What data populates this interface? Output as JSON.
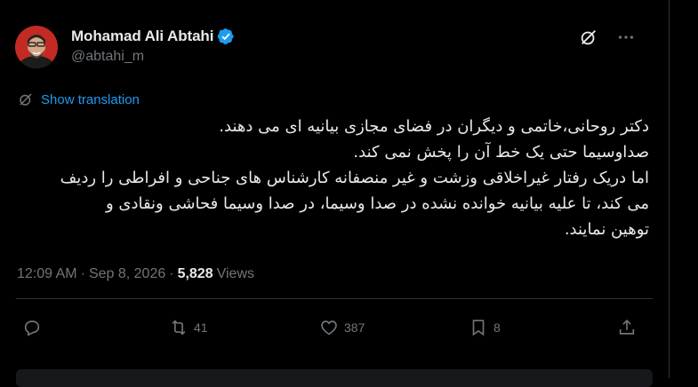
{
  "author": {
    "name": "Mohamad Ali Abtahi",
    "handle": "@abtahi_m",
    "verified": true,
    "verified_color": "#1d9bf0"
  },
  "translate_label": "Show translation",
  "tweet_lines": [
    "دکتر روحانی،خاتمی و دیگران در فضای مجازی بیانیه ای می دهند.",
    "صداوسیما حتی یک خط آن را پخش نمی کند.",
    "اما دریک رفتار غیراخلاقی وزشت و غیر منصفانه کارشناس های جناحی و افراطی را ردیف",
    "می کند، تا علیه بیانیه خوانده نشده در صدا وسیما، در صدا وسیما فحاشی ونقادی و",
    "توهین نمایند."
  ],
  "meta": {
    "time": "12:09 AM",
    "separator": "·",
    "date": "Sep 8, 2026",
    "views_count": "5,828",
    "views_label": "Views"
  },
  "actions": {
    "reply_icon": "reply-icon",
    "retweet_count": "41",
    "like_count": "387",
    "bookmark_count": "8",
    "share_icon": "share-icon"
  },
  "colors": {
    "background": "#000000",
    "text": "#e7e9ea",
    "muted": "#71767b",
    "accent": "#1d9bf0"
  }
}
